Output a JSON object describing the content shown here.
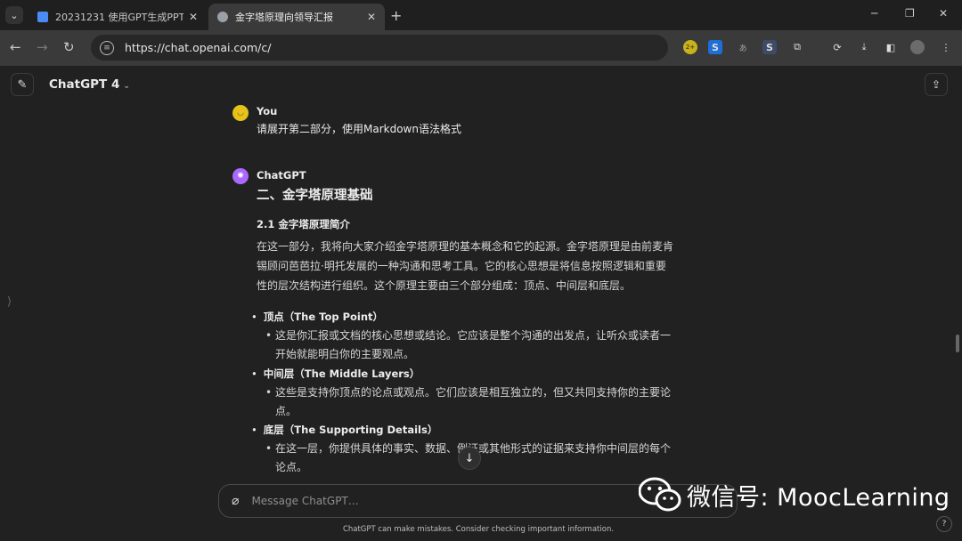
{
  "browser": {
    "tabs": [
      {
        "title": "20231231 使用GPT生成PPT课",
        "active": false,
        "favicon_color": "#4c8bf5"
      },
      {
        "title": "金字塔原理向领导汇报",
        "active": true,
        "favicon_color": "#9aa0a6"
      }
    ],
    "url": "https://chat.openai.com/c/",
    "extension_badge": "2+"
  },
  "header": {
    "model_label": "ChatGPT 4"
  },
  "conversation": {
    "user": {
      "name": "You",
      "message": "请展开第二部分，使用Markdown语法格式"
    },
    "assistant": {
      "name": "ChatGPT",
      "heading": "二、金字塔原理基础",
      "subheading": "2.1 金字塔原理简介",
      "paragraph": "在这一部分，我将向大家介绍金字塔原理的基本概念和它的起源。金字塔原理是由前麦肯锡顾问芭芭拉·明托发展的一种沟通和思考工具。它的核心思想是将信息按照逻辑和重要性的层次结构进行组织。这个原理主要由三个部分组成：顶点、中间层和底层。",
      "bullets": [
        {
          "title": "顶点（The Top Point）",
          "detail": "这是你汇报或文档的核心思想或结论。它应该是整个沟通的出发点，让听众或读者一开始就能明白你的主要观点。"
        },
        {
          "title": "中间层（The Middle Layers）",
          "detail": "这些是支持你顶点的论点或观点。它们应该是相互独立的，但又共同支持你的主要论点。"
        },
        {
          "title": "底层（The Supporting Details）",
          "detail": "在这一层，你提供具体的事实、数据、例证或其他形式的证据来支持你中间层的每个论点。"
        }
      ]
    }
  },
  "composer": {
    "placeholder": "Message ChatGPT…"
  },
  "footer": {
    "note": "ChatGPT can make mistakes. Consider checking important information.",
    "help": "?"
  },
  "watermark": {
    "text": "微信号: MoocLearning"
  },
  "colors": {
    "background": "#212121",
    "user_avatar": "#e6c21a",
    "gpt_avatar": "#ab68ff"
  }
}
